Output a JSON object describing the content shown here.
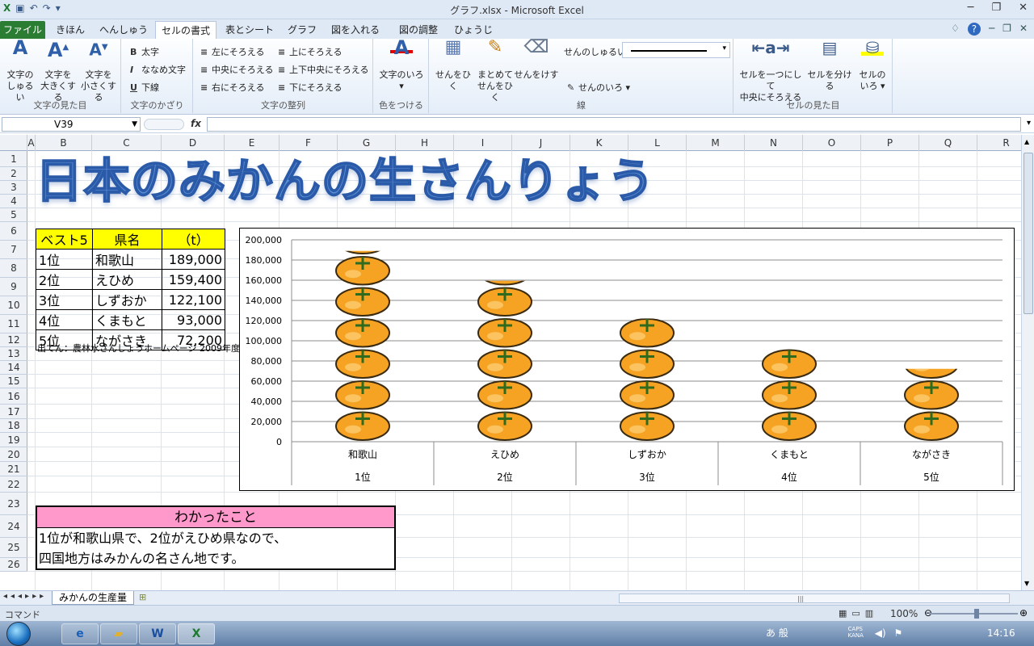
{
  "window": {
    "title": "グラフ.xlsx - Microsoft Excel"
  },
  "tabs": [
    "ファイル",
    "きほん",
    "へんしゅう",
    "セルの書式",
    "表とシート",
    "グラフ",
    "図を入れる",
    "図の調整",
    "ひょうじ"
  ],
  "ribbon": {
    "groups": {
      "moji_mie": "文字の見た目",
      "moji_kazari": "文字のかざり",
      "moji_seiretsu": "文字の整列",
      "iro": "色をつける",
      "sen": "線",
      "cell_mie": "セルの見た目"
    },
    "buttons": {
      "font_kind": [
        "文字の",
        "しゅるい"
      ],
      "font_bigger": [
        "文字を",
        "大きくする"
      ],
      "font_smaller": [
        "文字を",
        "小さくする"
      ],
      "bold": "太字",
      "italic": "ななめ文字",
      "underline": "下線",
      "align_left": "左にそろえる",
      "align_center": "中央にそろえる",
      "align_right": "右にそろえる",
      "align_top": "上にそろえる",
      "align_middle": "上下中央にそろえる",
      "align_bottom": "下にそろえる",
      "font_color": "文字のいろ",
      "draw_line": "せんをひく",
      "draw_lines": [
        "まとめて",
        "せんをひく"
      ],
      "erase_line": "せんをけす",
      "line_kind": "せんのしゅるい",
      "line_color": "せんのいろ",
      "merge": [
        "セルを一つにして",
        "中央にそろえる"
      ],
      "split": "セルを分ける",
      "cell_color": [
        "セルの",
        "いろ"
      ]
    }
  },
  "formula_bar": {
    "name_box": "V39",
    "fx": "fx",
    "formula": ""
  },
  "columns": [
    "A",
    "B",
    "C",
    "D",
    "E",
    "F",
    "G",
    "H",
    "I",
    "J",
    "K",
    "L",
    "M",
    "N",
    "O",
    "P",
    "Q",
    "R"
  ],
  "rows": [
    "1",
    "2",
    "3",
    "4",
    "5",
    "6",
    "7",
    "8",
    "9",
    "10",
    "11",
    "12",
    "13",
    "14",
    "15",
    "16",
    "17",
    "18",
    "19",
    "20",
    "21",
    "22",
    "23",
    "24",
    "25",
    "26"
  ],
  "sheet": {
    "title": "日本のみかんの生さんりょう",
    "table": {
      "headers": [
        "ベスト5",
        "県名",
        "（t）"
      ],
      "rows": [
        [
          "1位",
          "和歌山",
          "189,000"
        ],
        [
          "2位",
          "えひめ",
          "159,400"
        ],
        [
          "3位",
          "しずおか",
          "122,100"
        ],
        [
          "4位",
          "くまもと",
          "93,000"
        ],
        [
          "5位",
          "ながさき",
          "72,200"
        ]
      ]
    },
    "source": "出てん：農林水さんしょうホームページ 2009年度",
    "finding": {
      "header": "わかったこと",
      "lines": [
        "1位が和歌山県で、2位がえひめ県なので、",
        "四国地方はみかんの名さん地です。"
      ]
    }
  },
  "chart_data": {
    "type": "bar",
    "categories": [
      "和歌山",
      "えひめ",
      "しずおか",
      "くまもと",
      "ながさき"
    ],
    "category_ranks": [
      "1位",
      "2位",
      "3位",
      "4位",
      "5位"
    ],
    "values": [
      189000,
      159400,
      122100,
      93000,
      72200
    ],
    "ylim": [
      0,
      200000
    ],
    "yticks": [
      "200,000",
      "180,000",
      "160,000",
      "140,000",
      "120,000",
      "100,000",
      "80,000",
      "60,000",
      "40,000",
      "20,000",
      "0"
    ],
    "grid": true,
    "legend": "none",
    "bar_style": "stacked orange pictograph",
    "colors": {
      "orange": "#f6a323",
      "outline": "#3a2a10",
      "leaf": "#2e6b1e"
    }
  },
  "sheet_tabs": {
    "active": "みかんの生産量"
  },
  "status": {
    "mode": "コマンド",
    "zoom": "100%"
  },
  "taskbar": {
    "clock": "14:16",
    "ime": "あ 般",
    "caps": "CAPS",
    "kana": "KANA"
  }
}
